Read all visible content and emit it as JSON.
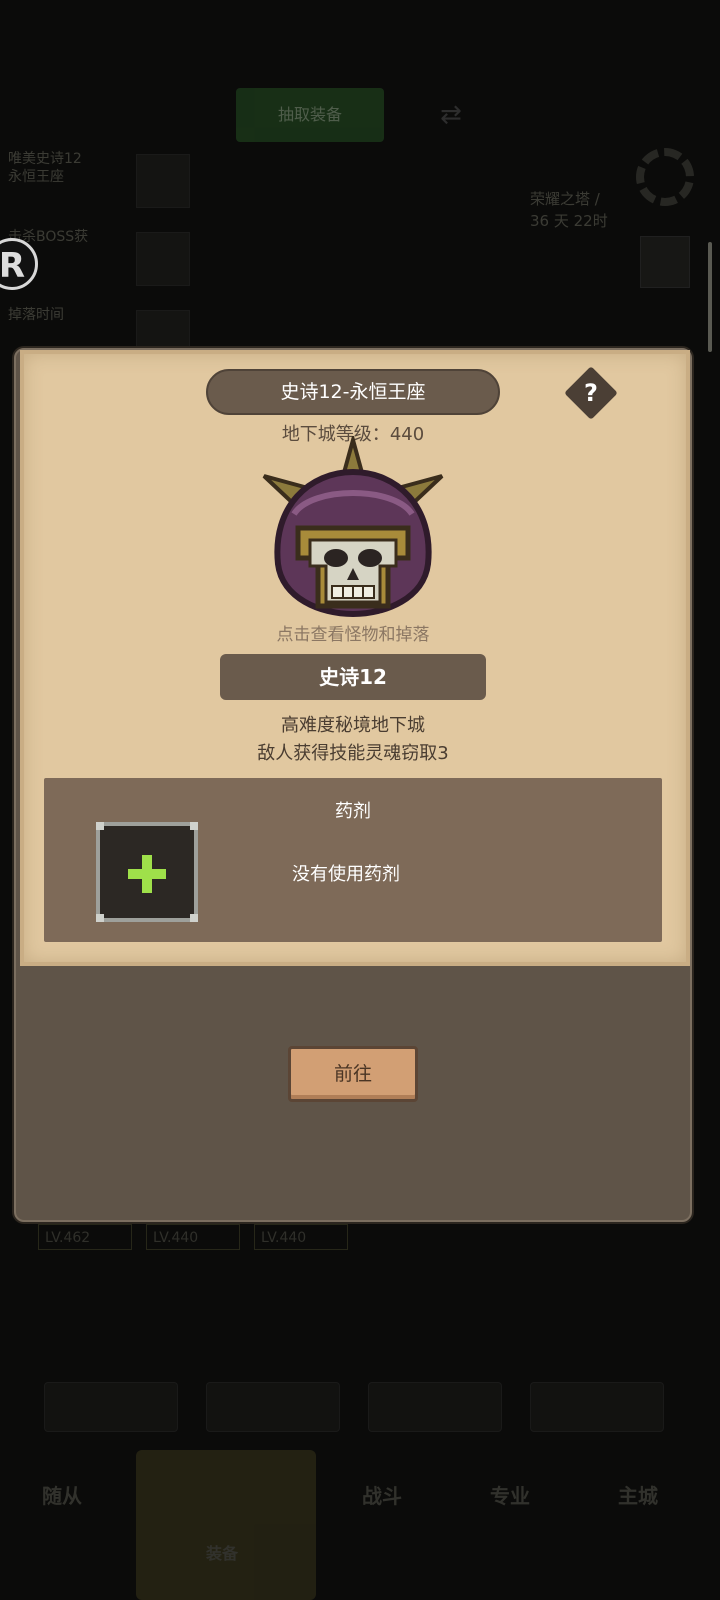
{
  "background": {
    "top_button": "抽取装备",
    "side_list": [
      {
        "line1": "唯美史诗12",
        "line2": "永恒王座"
      },
      {
        "line1": "击杀BOSS获",
        "line2": "得"
      },
      {
        "line1": "掉落时间",
        "line2": ""
      }
    ],
    "right_text": [
      "荣耀之塔 /",
      "36 天 22时"
    ],
    "levels": [
      "LV.462",
      "LV.440",
      "LV.440"
    ],
    "bottom_buttons": [
      "",
      "",
      "",
      ""
    ],
    "nav": [
      "随从",
      "装备",
      "战斗",
      "专业",
      "主城"
    ]
  },
  "badge": {
    "letter": "R"
  },
  "modal": {
    "title": "史诗12-永恒王座",
    "help_label": "?",
    "dungeon_level_label": "地下城等级：",
    "dungeon_level_value": "440",
    "tap_hint": "点击查看怪物和掉落",
    "tier": "史诗12",
    "desc_line1": "高难度秘境地下城",
    "desc_line2": "敌人获得技能灵魂窃取3",
    "potion_title": "药剂",
    "potion_status": "没有使用药剂",
    "go_button": "前往"
  }
}
